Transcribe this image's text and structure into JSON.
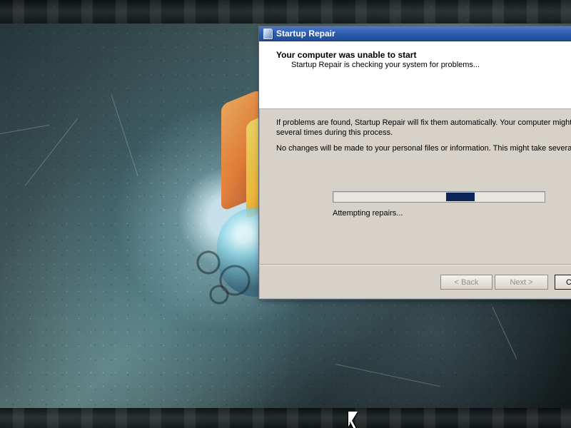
{
  "window": {
    "title": "Startup Repair",
    "icon": "startup-repair-window-icon"
  },
  "header": {
    "title": "Your computer was unable to start",
    "subtitle": "Startup Repair is checking your system for problems..."
  },
  "content": {
    "description": "If problems are found, Startup Repair will fix them automatically. Your computer might\nseveral times during this process.",
    "privacy_note": "No changes will be made to your personal files or information. This might take several m",
    "status": "Attempting repairs...",
    "progress_indicator": {
      "type": "indeterminate",
      "active_segment_color": "#0c2459"
    }
  },
  "buttons": {
    "back": "< Back",
    "next": "Next >",
    "cancel": "C"
  },
  "colors": {
    "titlebar": "#2d5cae",
    "dialog_background": "#d6d2ca",
    "header_background": "#ffffff"
  },
  "desktop": {
    "cursor_icon": "mouse-pointer-icon",
    "decoration": "textured Windows flag wallpaper"
  }
}
